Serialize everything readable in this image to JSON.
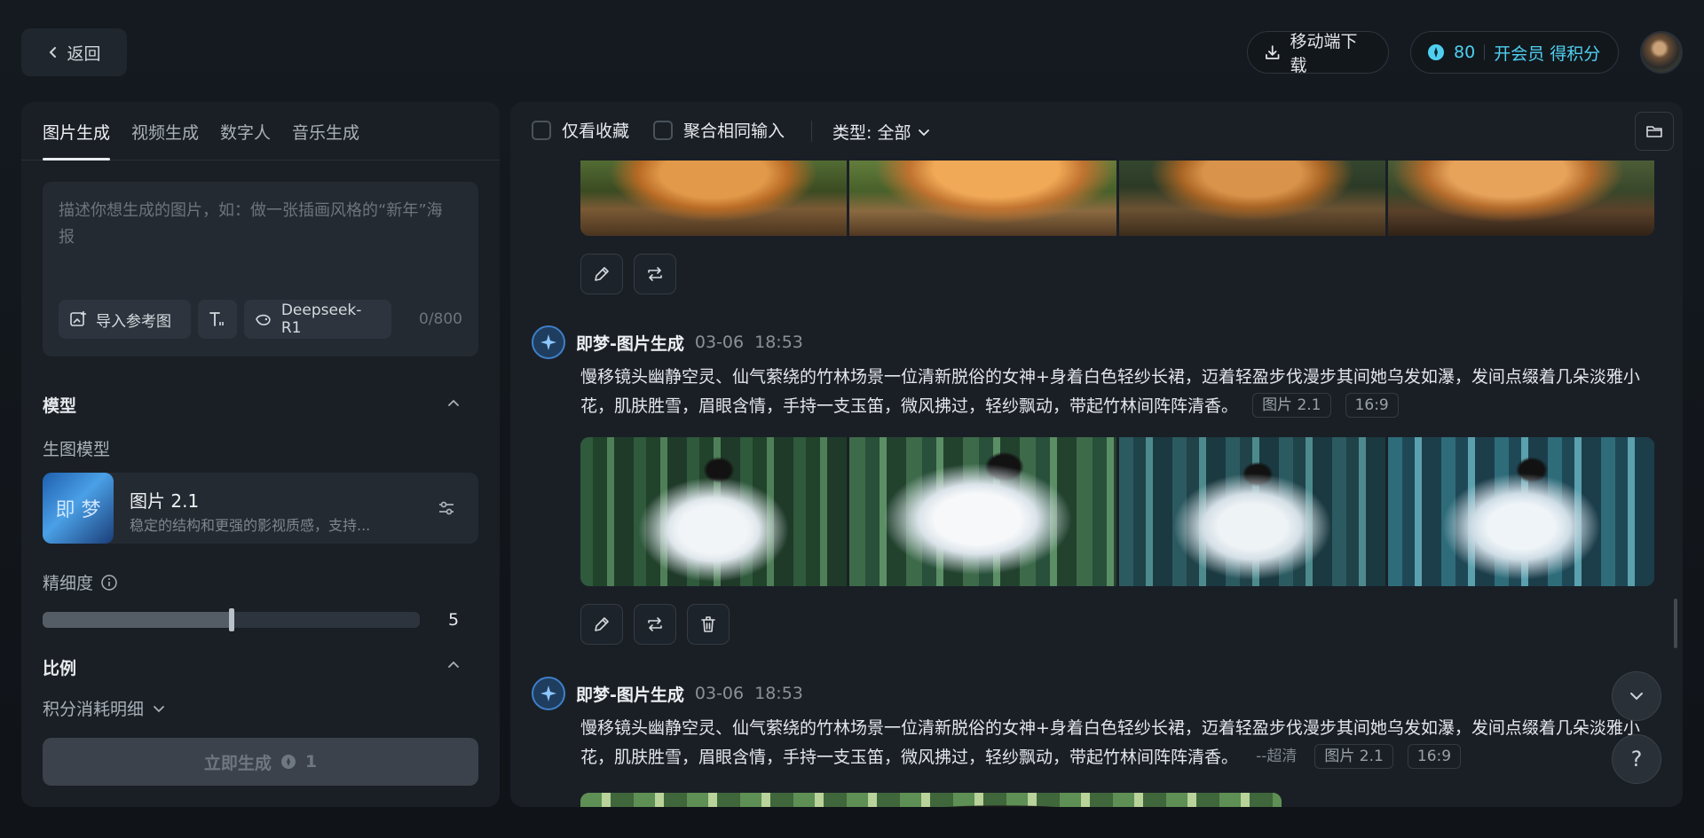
{
  "header": {
    "back_label": "返回",
    "download_label": "移动端下载",
    "credits": "80",
    "vip_label": "开会员 得积分"
  },
  "left": {
    "tabs": [
      {
        "label": "图片生成",
        "active": true
      },
      {
        "label": "视频生成",
        "active": false
      },
      {
        "label": "数字人",
        "active": false
      },
      {
        "label": "音乐生成",
        "active": false
      }
    ],
    "prompt": {
      "placeholder": "描述你想生成的图片，如：做一张插画风格的“新年”海报",
      "counter": "0/800"
    },
    "chips": {
      "ref_label": "导入参考图",
      "deepseek_label": "Deepseek-R1"
    },
    "model_section_title": "模型",
    "model_sub_label": "生图模型",
    "model": {
      "name": "图片 2.1",
      "desc": "稳定的结构和更强的影视质感，支持...",
      "thumb_text": "即 梦"
    },
    "precision_label": "精细度",
    "precision_value": "5",
    "precision_fraction": 0.5,
    "ratio_section_title": "比例",
    "cost_label": "积分消耗明细",
    "generate_label": "立即生成",
    "generate_cost": "1"
  },
  "right": {
    "filters": {
      "fav_only": "仅看收藏",
      "merge_same": "聚合相同输入",
      "type_label": "类型: 全部"
    },
    "entries": [
      {
        "name": "即梦-图片生成",
        "date": "03-06",
        "time": "18:53",
        "prompt": "慢移镜头幽静空灵、仙气萦绕的竹林场景一位清新脱俗的女神+身着白色轻纱长裙，迈着轻盈步伐漫步其间她乌发如瀑，发间点缀着几朵淡雅小花，肌肤胜雪，眉眼含情，手持一支玉笛，微风拂过，轻纱飘动，带起竹林间阵阵清香。",
        "tags": [
          "图片 2.1",
          "16:9"
        ]
      },
      {
        "name": "即梦-图片生成",
        "date": "03-06",
        "time": "18:53",
        "prompt": "慢移镜头幽静空灵、仙气萦绕的竹林场景一位清新脱俗的女神+身着白色轻纱长裙，迈着轻盈步伐漫步其间她乌发如瀑，发间点缀着几朵淡雅小花，肌肤胜雪，眉眼含情，手持一支玉笛，微风拂过，轻纱飘动，带起竹林间阵阵清香。",
        "quality": "--超清",
        "tags": [
          "图片 2.1",
          "16:9"
        ]
      }
    ]
  },
  "floating": {
    "help_label": "?"
  }
}
